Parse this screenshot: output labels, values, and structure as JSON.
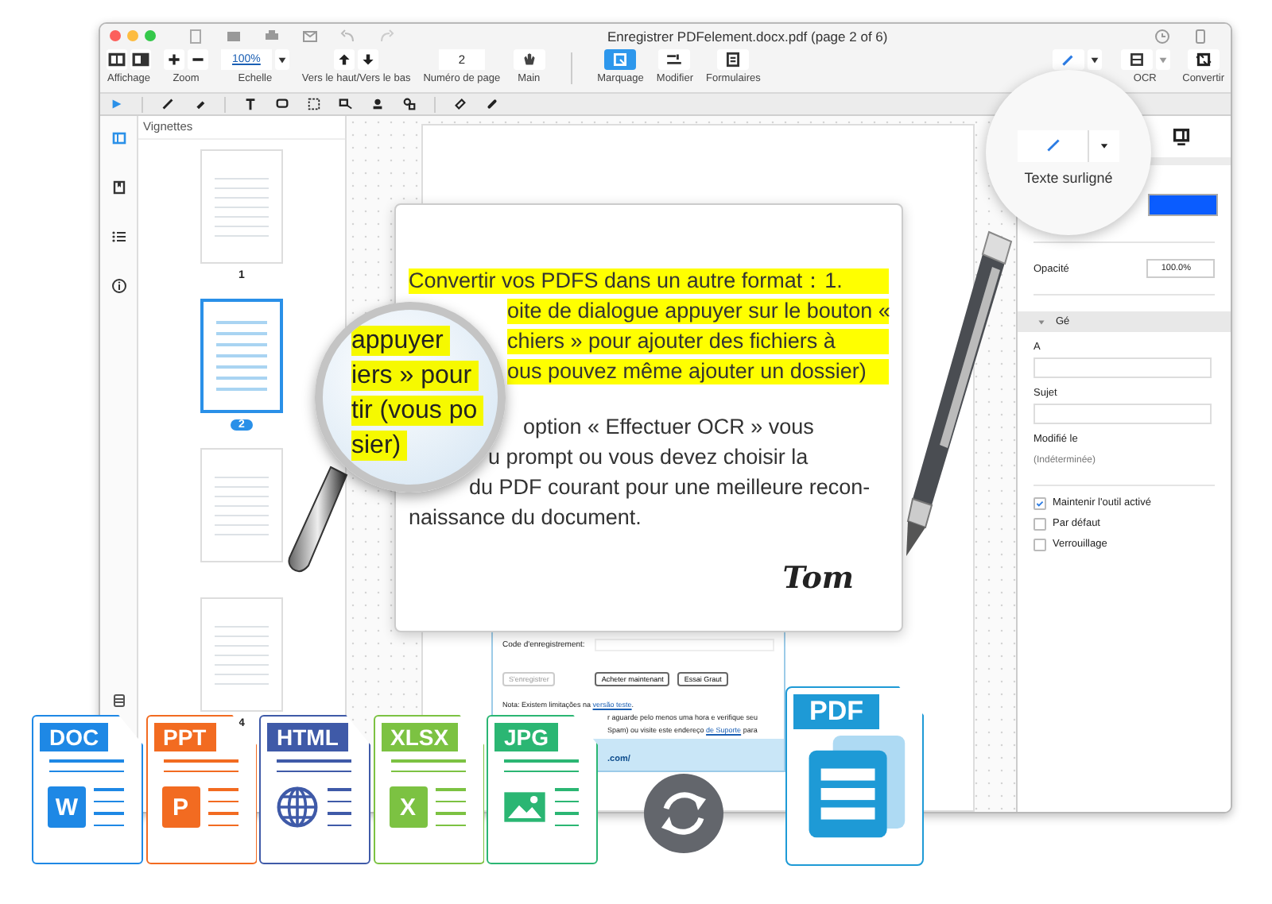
{
  "window": {
    "title": "Enregistrer PDFelement.docx.pdf (page 2 of 6)"
  },
  "toolbar": [
    {
      "kind": "view",
      "label": "Affichage"
    },
    {
      "kind": "zoom",
      "label": "Zoom"
    },
    {
      "kind": "scale",
      "label": "Echelle",
      "value": "100%"
    },
    {
      "kind": "nav",
      "label": "Vers le haut/Vers le bas"
    },
    {
      "kind": "page",
      "label": "Numéro de page",
      "value": "2"
    },
    {
      "kind": "hand",
      "label": "Main"
    }
  ],
  "modes": [
    {
      "kind": "markup",
      "label": "Marquage",
      "selected": true
    },
    {
      "kind": "edit",
      "label": "Modifier",
      "selected": false
    },
    {
      "kind": "forms",
      "label": "Formulaires",
      "selected": false
    }
  ],
  "right_tools": [
    {
      "kind": "ocr",
      "label": "OCR"
    },
    {
      "kind": "convert",
      "label": "Convertir"
    }
  ],
  "sidebar": {
    "title": "Vignettes",
    "thumbnails": [
      {
        "page": "1",
        "selected": false
      },
      {
        "page": "2",
        "selected": true
      },
      {
        "selected": false
      },
      {
        "page": "4",
        "selected": false
      }
    ]
  },
  "document": {
    "lines": [
      {
        "text": "Convertir vos PDFS dans un autre format：1.",
        "highlighted": true
      },
      {
        "text": "oite de dialogue appuyer sur le bouton «",
        "highlighted": true
      },
      {
        "text": "chiers » pour ajouter des fichiers à",
        "highlighted": true
      },
      {
        "text": "ous pouvez même ajouter un dossier)",
        "highlighted": true
      },
      {
        "text": "option « Effectuer OCR » vous",
        "highlighted": false
      },
      {
        "text": "u prompt ou vous devez choisir la",
        "highlighted": false
      },
      {
        "text": "du PDF courant pour une meilleure recon-",
        "highlighted": false
      },
      {
        "text": "naissance du document.",
        "highlighted": false
      }
    ],
    "signature": "Tom"
  },
  "magnifier": {
    "lines": [
      {
        "text": "appuyer",
        "highlighted": true
      },
      {
        "text": "iers » pour",
        "highlighted": true
      },
      {
        "text": "tir (vous po",
        "highlighted": true
      },
      {
        "text": "sier)",
        "highlighted": true
      }
    ]
  },
  "registration": {
    "field_label": "Code d'enregistrement:",
    "buttons": [
      {
        "label": "S'enregistrer",
        "disabled": true
      },
      {
        "label": "Acheter maintenant",
        "disabled": false
      },
      {
        "label": "Essai Graut",
        "disabled": false
      }
    ],
    "note": [
      [
        {
          "text": "Nota: Existem limitações na ",
          "link": false
        },
        {
          "text": "versão teste",
          "link": true
        },
        {
          "text": ".",
          "link": false
        }
      ],
      [
        {
          "text": "r aguarde pelo menos uma hora e verifique seu",
          "link": false
        }
      ],
      [
        {
          "text": "Spam) ou visite este endereço ",
          "link": false
        },
        {
          "text": "de Suporte",
          "link": true
        },
        {
          "text": " para",
          "link": false
        }
      ]
    ],
    "footer": ".com/"
  },
  "callout": {
    "label": "Texte surligné"
  },
  "properties": {
    "color": "#0a5cff",
    "opacity_label": "Opacité",
    "opacity": "100.0%",
    "section": "Gé",
    "author_label": "A",
    "subject_label": "Sujet",
    "modified_label": "Modifié le",
    "modified": "(Indéterminée)",
    "options": [
      {
        "label": "Maintenir l'outil activé",
        "checked": true
      },
      {
        "label": "Par défaut",
        "checked": false
      },
      {
        "label": "Verrouillage",
        "checked": false
      }
    ]
  },
  "file_types": [
    {
      "label": "DOC",
      "color": "#1e88e5",
      "kind": "word",
      "letter": "W"
    },
    {
      "label": "PPT",
      "color": "#f26b21",
      "kind": "powerpoint",
      "letter": "P"
    },
    {
      "label": "HTML",
      "color": "#3f5aa8",
      "kind": "web"
    },
    {
      "label": "XLSX",
      "color": "#7cc242",
      "kind": "excel",
      "letter": "X"
    },
    {
      "label": "JPG",
      "color": "#2bb673",
      "kind": "image"
    }
  ],
  "target": {
    "label": "PDF"
  }
}
